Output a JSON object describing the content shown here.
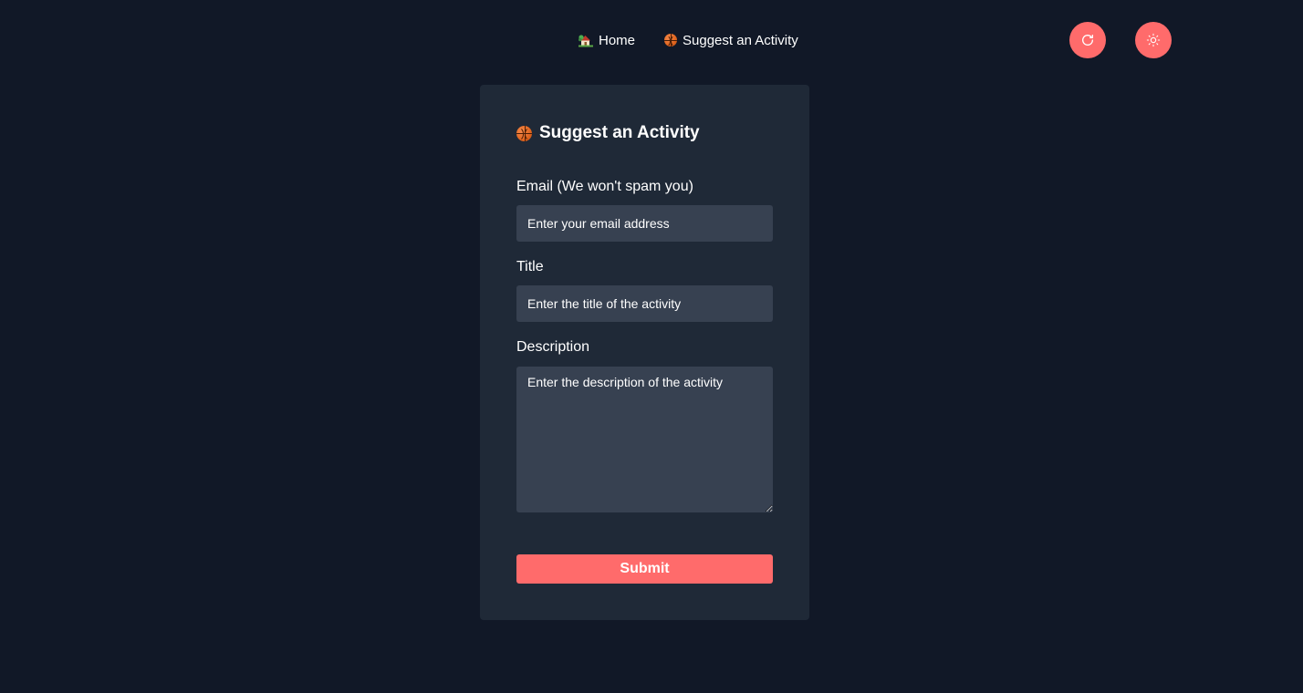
{
  "nav": {
    "items": [
      {
        "icon": "house-with-garden-icon",
        "label": "Home"
      },
      {
        "icon": "basketball-icon",
        "label": "Suggest an Activity"
      }
    ]
  },
  "actions": {
    "refresh_icon": "refresh-icon",
    "theme_icon": "sun-icon"
  },
  "form": {
    "title": "Suggest an Activity",
    "title_icon": "basketball-icon",
    "email": {
      "label": "Email (We won't spam you)",
      "placeholder": "Enter your email address",
      "value": ""
    },
    "title_field": {
      "label": "Title",
      "placeholder": "Enter the title of the activity",
      "value": ""
    },
    "description": {
      "label": "Description",
      "placeholder": "Enter the description of the activity",
      "value": ""
    },
    "submit_label": "Submit"
  },
  "colors": {
    "background": "#111827",
    "card": "#1f2937",
    "input": "#374151",
    "accent": "#ff6b6b",
    "text": "#ffffff"
  }
}
